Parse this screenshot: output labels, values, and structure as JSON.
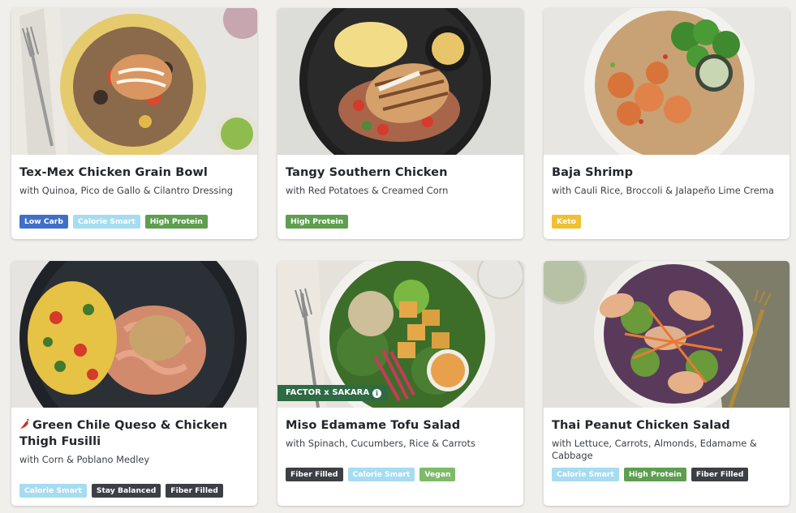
{
  "meals": [
    {
      "title": "Tex-Mex Chicken Grain Bowl",
      "subtitle": "with Quinoa, Pico de Gallo & Cilantro Dressing",
      "tags": [
        "Low Carb",
        "Calorie Smart",
        "High Protein"
      ]
    },
    {
      "title": "Tangy Southern Chicken",
      "subtitle": "with Red Potatoes & Creamed Corn",
      "tags": [
        "High Protein"
      ]
    },
    {
      "title": "Baja Shrimp",
      "subtitle": "with Cauli Rice, Broccoli & Jalapeño Lime Crema",
      "tags": [
        "Keto"
      ]
    },
    {
      "title": "Green Chile Queso & Chicken Thigh Fusilli",
      "subtitle": "with Corn & Poblano Medley",
      "tags": [
        "Calorie Smart",
        "Stay Balanced",
        "Fiber Filled"
      ],
      "icon": "chili-pepper-icon"
    },
    {
      "title": "Miso Edamame Tofu Salad",
      "subtitle": "with Spinach, Cucumbers, Rice & Carrots",
      "tags": [
        "Fiber Filled",
        "Calorie Smart",
        "Vegan"
      ],
      "ribbon": "FACTOR x SAKARA"
    },
    {
      "title": "Thai Peanut Chicken Salad",
      "subtitle": "with Lettuce, Carrots, Almonds, Edamame & Cabbage",
      "tags": [
        "Calorie Smart",
        "High Protein",
        "Fiber Filled"
      ]
    }
  ],
  "colors": {
    "low_carb": "#3f6fc8",
    "calorie_smart": "#a6dcf2",
    "high_protein": "#5d9e4f",
    "keto": "#f0c030",
    "fiber_filled": "#3c3f44",
    "vegan": "#7dba6a",
    "stay_balanced": "#3c3f44",
    "ribbon": "#2e6b45"
  }
}
